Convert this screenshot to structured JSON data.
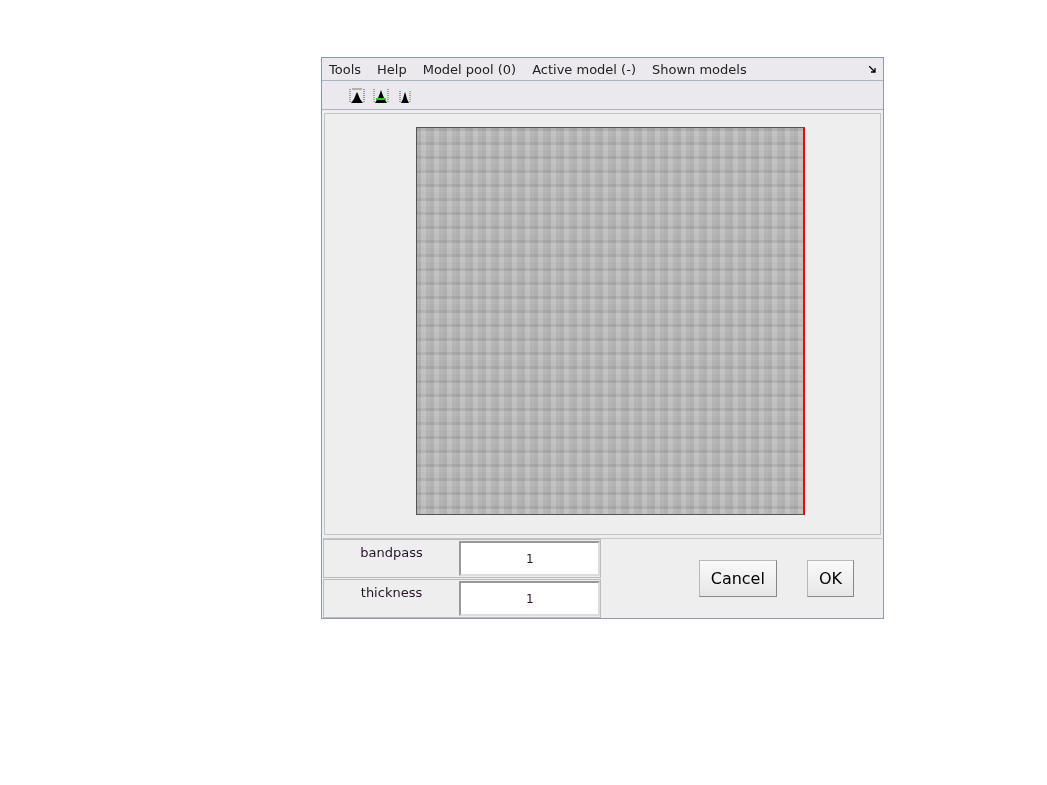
{
  "menu": [
    {
      "label": "Tools"
    },
    {
      "label": "Help"
    },
    {
      "label": "Model pool (0)"
    },
    {
      "label": "Active model (-)"
    },
    {
      "label": "Shown models"
    }
  ],
  "toolbar": {
    "tools": [
      {
        "kind": "range"
      },
      {
        "kind": "center"
      },
      {
        "kind": "narrow"
      }
    ]
  },
  "fields": [
    {
      "label": "bandpass",
      "value": "1"
    },
    {
      "label": "thickness",
      "value": "1"
    }
  ],
  "buttons": [
    {
      "label": "Cancel"
    },
    {
      "label": "OK"
    }
  ]
}
